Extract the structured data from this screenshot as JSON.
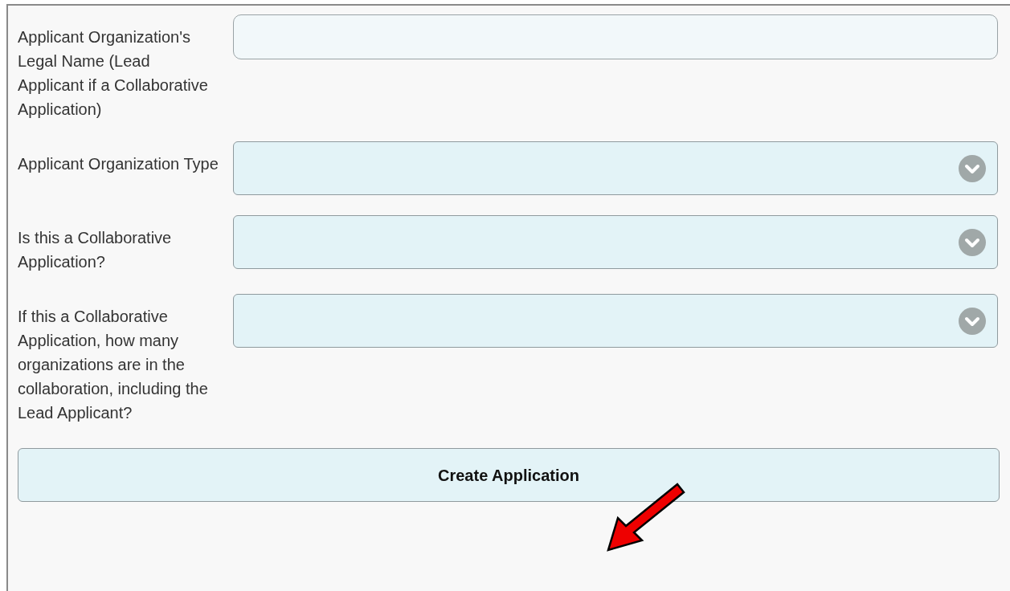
{
  "fields": [
    {
      "kind": "text",
      "label": "Applicant Organization's Legal Name (Lead Applicant if a Collaborative Application)"
    },
    {
      "kind": "select",
      "label": "Applicant Organization Type"
    },
    {
      "kind": "select",
      "label": "Is this a Collaborative Application?"
    },
    {
      "kind": "select",
      "label": "If this a Collaborative Application, how many organizations are in the collaboration, including the Lead Applicant?"
    }
  ],
  "submit_button": {
    "label": "Create Application"
  }
}
